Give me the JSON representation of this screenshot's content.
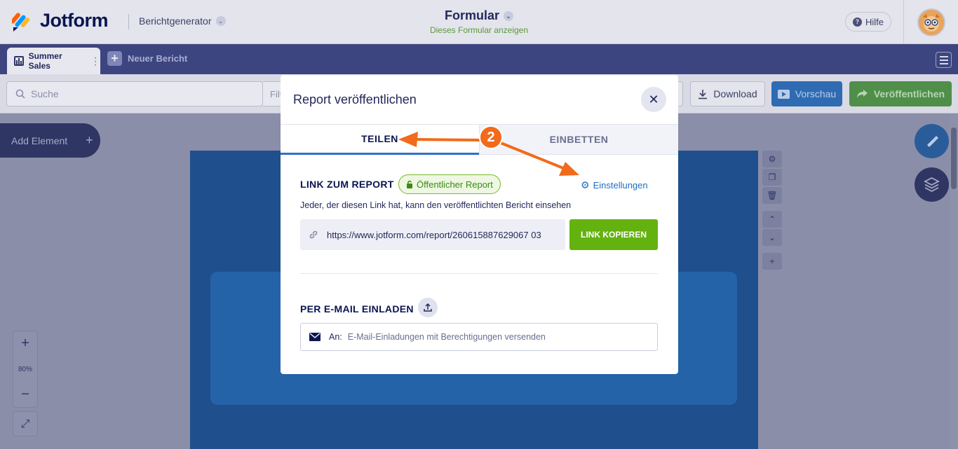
{
  "header": {
    "logo_text": "Jotform",
    "generator_label": "Berichtgenerator",
    "form_title": "Formular",
    "form_subtitle": "Dieses Formular anzeigen",
    "help_label": "Hilfe"
  },
  "tabs": {
    "active_label": "Summer Sales",
    "new_label": "Neuer Bericht"
  },
  "toolbar": {
    "search_placeholder": "Suche",
    "filter_label": "Filt",
    "download_label": "Download",
    "preview_label": "Vorschau",
    "publish_label": "Veröffentlichen"
  },
  "canvas": {
    "add_element_label": "Add Element",
    "zoom_level": "80%"
  },
  "modal": {
    "title": "Report veröffentlichen",
    "tab_share": "TEILEN",
    "tab_embed": "EINBETTEN",
    "link_section_title": "LINK ZUM REPORT",
    "public_badge": "Öffentlicher Report",
    "settings_label": "Einstellungen",
    "description": "Jeder, der diesen Link hat, kann den veröffentlichten Bericht einsehen",
    "report_url": "https://www.jotform.com/report/260615887629067 03",
    "copy_button": "LINK KOPIEREN",
    "email_section_title": "PER E-MAIL EINLADEN",
    "email_to_label": "An:",
    "email_placeholder": "E-Mail-Einladungen mit Berechtigungen versenden"
  },
  "annotation": {
    "step_number": "2",
    "color": "#f26a1b"
  },
  "colors": {
    "brand_navy": "#0a1551",
    "accent_blue": "#2d70c9",
    "copy_green": "#64b20f",
    "badge_green": "#3a8a14"
  }
}
